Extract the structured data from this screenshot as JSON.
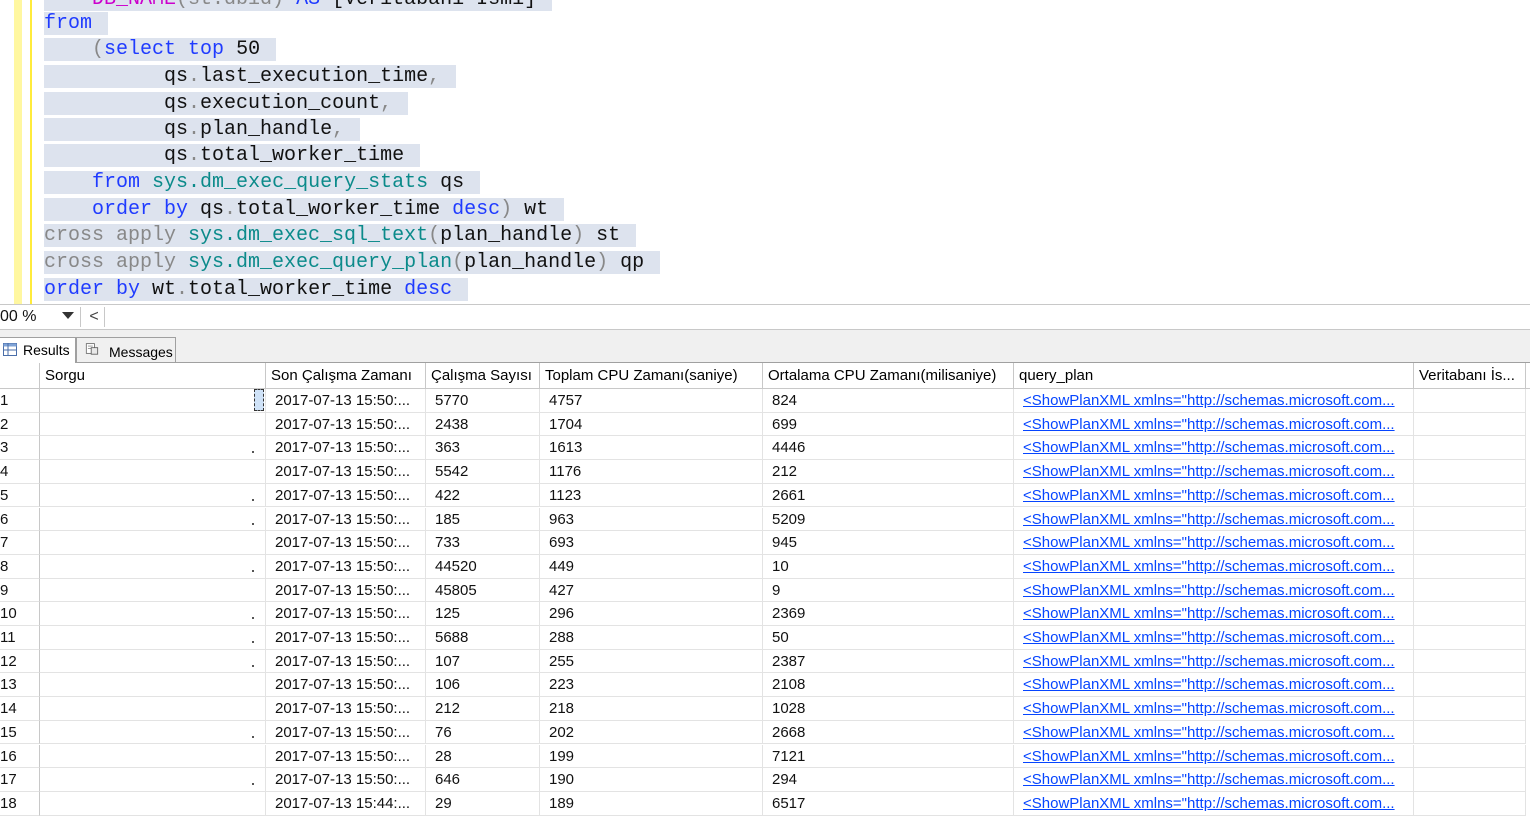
{
  "editor": {
    "lines": [
      {
        "segments": [
          {
            "t": "    ",
            "c": "tx"
          },
          {
            "t": "DB_NAME",
            "c": "mg"
          },
          {
            "t": "(st.dbid) ",
            "c": "gr"
          },
          {
            "t": "AS",
            "c": "kw"
          },
          {
            "t": " [Veritabanı İsmi]",
            "c": "tx"
          }
        ]
      },
      {
        "segments": [
          {
            "t": "from",
            "c": "kw"
          }
        ]
      },
      {
        "segments": [
          {
            "t": "    (",
            "c": "gr"
          },
          {
            "t": "select",
            "c": "kw"
          },
          {
            "t": " ",
            "c": "tx"
          },
          {
            "t": "top",
            "c": "kw"
          },
          {
            "t": " 50",
            "c": "tx"
          }
        ]
      },
      {
        "segments": [
          {
            "t": "          qs",
            "c": "tx"
          },
          {
            "t": ".",
            "c": "gr"
          },
          {
            "t": "last_execution_time",
            "c": "tx"
          },
          {
            "t": ",",
            "c": "gr"
          }
        ]
      },
      {
        "segments": [
          {
            "t": "          qs",
            "c": "tx"
          },
          {
            "t": ".",
            "c": "gr"
          },
          {
            "t": "execution_count",
            "c": "tx"
          },
          {
            "t": ",",
            "c": "gr"
          }
        ]
      },
      {
        "segments": [
          {
            "t": "          qs",
            "c": "tx"
          },
          {
            "t": ".",
            "c": "gr"
          },
          {
            "t": "plan_handle",
            "c": "tx"
          },
          {
            "t": ",",
            "c": "gr"
          }
        ]
      },
      {
        "segments": [
          {
            "t": "          qs",
            "c": "tx"
          },
          {
            "t": ".",
            "c": "gr"
          },
          {
            "t": "total_worker_time",
            "c": "tx"
          }
        ]
      },
      {
        "segments": [
          {
            "t": "    ",
            "c": "tx"
          },
          {
            "t": "from",
            "c": "kw"
          },
          {
            "t": " ",
            "c": "tx"
          },
          {
            "t": "sys.dm_exec_query_stats",
            "c": "fn"
          },
          {
            "t": " qs",
            "c": "tx"
          }
        ]
      },
      {
        "segments": [
          {
            "t": "    ",
            "c": "tx"
          },
          {
            "t": "order by",
            "c": "kw"
          },
          {
            "t": " qs",
            "c": "tx"
          },
          {
            "t": ".",
            "c": "gr"
          },
          {
            "t": "total_worker_time ",
            "c": "tx"
          },
          {
            "t": "desc",
            "c": "kw"
          },
          {
            "t": ")",
            "c": "gr"
          },
          {
            "t": " wt",
            "c": "tx"
          }
        ]
      },
      {
        "segments": [
          {
            "t": "cross apply ",
            "c": "gr"
          },
          {
            "t": "sys.dm_exec_sql_text",
            "c": "fn"
          },
          {
            "t": "(",
            "c": "gr"
          },
          {
            "t": "plan_handle",
            "c": "tx"
          },
          {
            "t": ")",
            "c": "gr"
          },
          {
            "t": " st",
            "c": "tx"
          }
        ]
      },
      {
        "segments": [
          {
            "t": "cross apply ",
            "c": "gr"
          },
          {
            "t": "sys.dm_exec_query_plan",
            "c": "fn"
          },
          {
            "t": "(",
            "c": "gr"
          },
          {
            "t": "plan_handle",
            "c": "tx"
          },
          {
            "t": ")",
            "c": "gr"
          },
          {
            "t": " qp",
            "c": "tx"
          }
        ]
      },
      {
        "segments": [
          {
            "t": "order by",
            "c": "kw"
          },
          {
            "t": " wt",
            "c": "tx"
          },
          {
            "t": ".",
            "c": "gr"
          },
          {
            "t": "total_worker_time ",
            "c": "tx"
          },
          {
            "t": "desc",
            "c": "kw"
          }
        ]
      }
    ]
  },
  "zoom": {
    "value": "00 %",
    "scroll_left": "<"
  },
  "tabs": {
    "results": "Results",
    "messages": "Messages"
  },
  "grid": {
    "columns": [
      "Sorgu",
      "Son Çalışma Zamanı",
      "Çalışma Sayısı",
      "Toplam CPU Zamanı(saniye)",
      "Ortalama CPU Zamanı(milisaniye)",
      "query_plan",
      "Veritabanı İs..."
    ],
    "rows": [
      {
        "n": "1",
        "time": "2017-07-13 15:50:...",
        "count": "5770",
        "total": "4757",
        "avg": "824",
        "plan": "<ShowPlanXML xmlns=\"http://schemas.microsoft.com..."
      },
      {
        "n": "2",
        "time": "2017-07-13 15:50:...",
        "count": "2438",
        "total": "1704",
        "avg": "699",
        "plan": "<ShowPlanXML xmlns=\"http://schemas.microsoft.com..."
      },
      {
        "n": "3",
        "time": "2017-07-13 15:50:...",
        "count": "363",
        "total": "1613",
        "avg": "4446",
        "plan": "<ShowPlanXML xmlns=\"http://schemas.microsoft.com..."
      },
      {
        "n": "4",
        "time": "2017-07-13 15:50:...",
        "count": "5542",
        "total": "1176",
        "avg": "212",
        "plan": "<ShowPlanXML xmlns=\"http://schemas.microsoft.com..."
      },
      {
        "n": "5",
        "time": "2017-07-13 15:50:...",
        "count": "422",
        "total": "1123",
        "avg": "2661",
        "plan": "<ShowPlanXML xmlns=\"http://schemas.microsoft.com..."
      },
      {
        "n": "6",
        "time": "2017-07-13 15:50:...",
        "count": "185",
        "total": "963",
        "avg": "5209",
        "plan": "<ShowPlanXML xmlns=\"http://schemas.microsoft.com..."
      },
      {
        "n": "7",
        "time": "2017-07-13 15:50:...",
        "count": "733",
        "total": "693",
        "avg": "945",
        "plan": "<ShowPlanXML xmlns=\"http://schemas.microsoft.com..."
      },
      {
        "n": "8",
        "time": "2017-07-13 15:50:...",
        "count": "44520",
        "total": "449",
        "avg": "10",
        "plan": "<ShowPlanXML xmlns=\"http://schemas.microsoft.com..."
      },
      {
        "n": "9",
        "time": "2017-07-13 15:50:...",
        "count": "45805",
        "total": "427",
        "avg": "9",
        "plan": "<ShowPlanXML xmlns=\"http://schemas.microsoft.com..."
      },
      {
        "n": "10",
        "time": "2017-07-13 15:50:...",
        "count": "125",
        "total": "296",
        "avg": "2369",
        "plan": "<ShowPlanXML xmlns=\"http://schemas.microsoft.com..."
      },
      {
        "n": "11",
        "time": "2017-07-13 15:50:...",
        "count": "5688",
        "total": "288",
        "avg": "50",
        "plan": "<ShowPlanXML xmlns=\"http://schemas.microsoft.com..."
      },
      {
        "n": "12",
        "time": "2017-07-13 15:50:...",
        "count": "107",
        "total": "255",
        "avg": "2387",
        "plan": "<ShowPlanXML xmlns=\"http://schemas.microsoft.com..."
      },
      {
        "n": "13",
        "time": "2017-07-13 15:50:...",
        "count": "106",
        "total": "223",
        "avg": "2108",
        "plan": "<ShowPlanXML xmlns=\"http://schemas.microsoft.com..."
      },
      {
        "n": "14",
        "time": "2017-07-13 15:50:...",
        "count": "212",
        "total": "218",
        "avg": "1028",
        "plan": "<ShowPlanXML xmlns=\"http://schemas.microsoft.com..."
      },
      {
        "n": "15",
        "time": "2017-07-13 15:50:...",
        "count": "76",
        "total": "202",
        "avg": "2668",
        "plan": "<ShowPlanXML xmlns=\"http://schemas.microsoft.com..."
      },
      {
        "n": "16",
        "time": "2017-07-13 15:50:...",
        "count": "28",
        "total": "199",
        "avg": "7121",
        "plan": "<ShowPlanXML xmlns=\"http://schemas.microsoft.com..."
      },
      {
        "n": "17",
        "time": "2017-07-13 15:50:...",
        "count": "646",
        "total": "190",
        "avg": "294",
        "plan": "<ShowPlanXML xmlns=\"http://schemas.microsoft.com..."
      },
      {
        "n": "18",
        "time": "2017-07-13 15:44:...",
        "count": "29",
        "total": "189",
        "avg": "6517",
        "plan": "<ShowPlanXML xmlns=\"http://schemas.microsoft.com..."
      }
    ]
  }
}
